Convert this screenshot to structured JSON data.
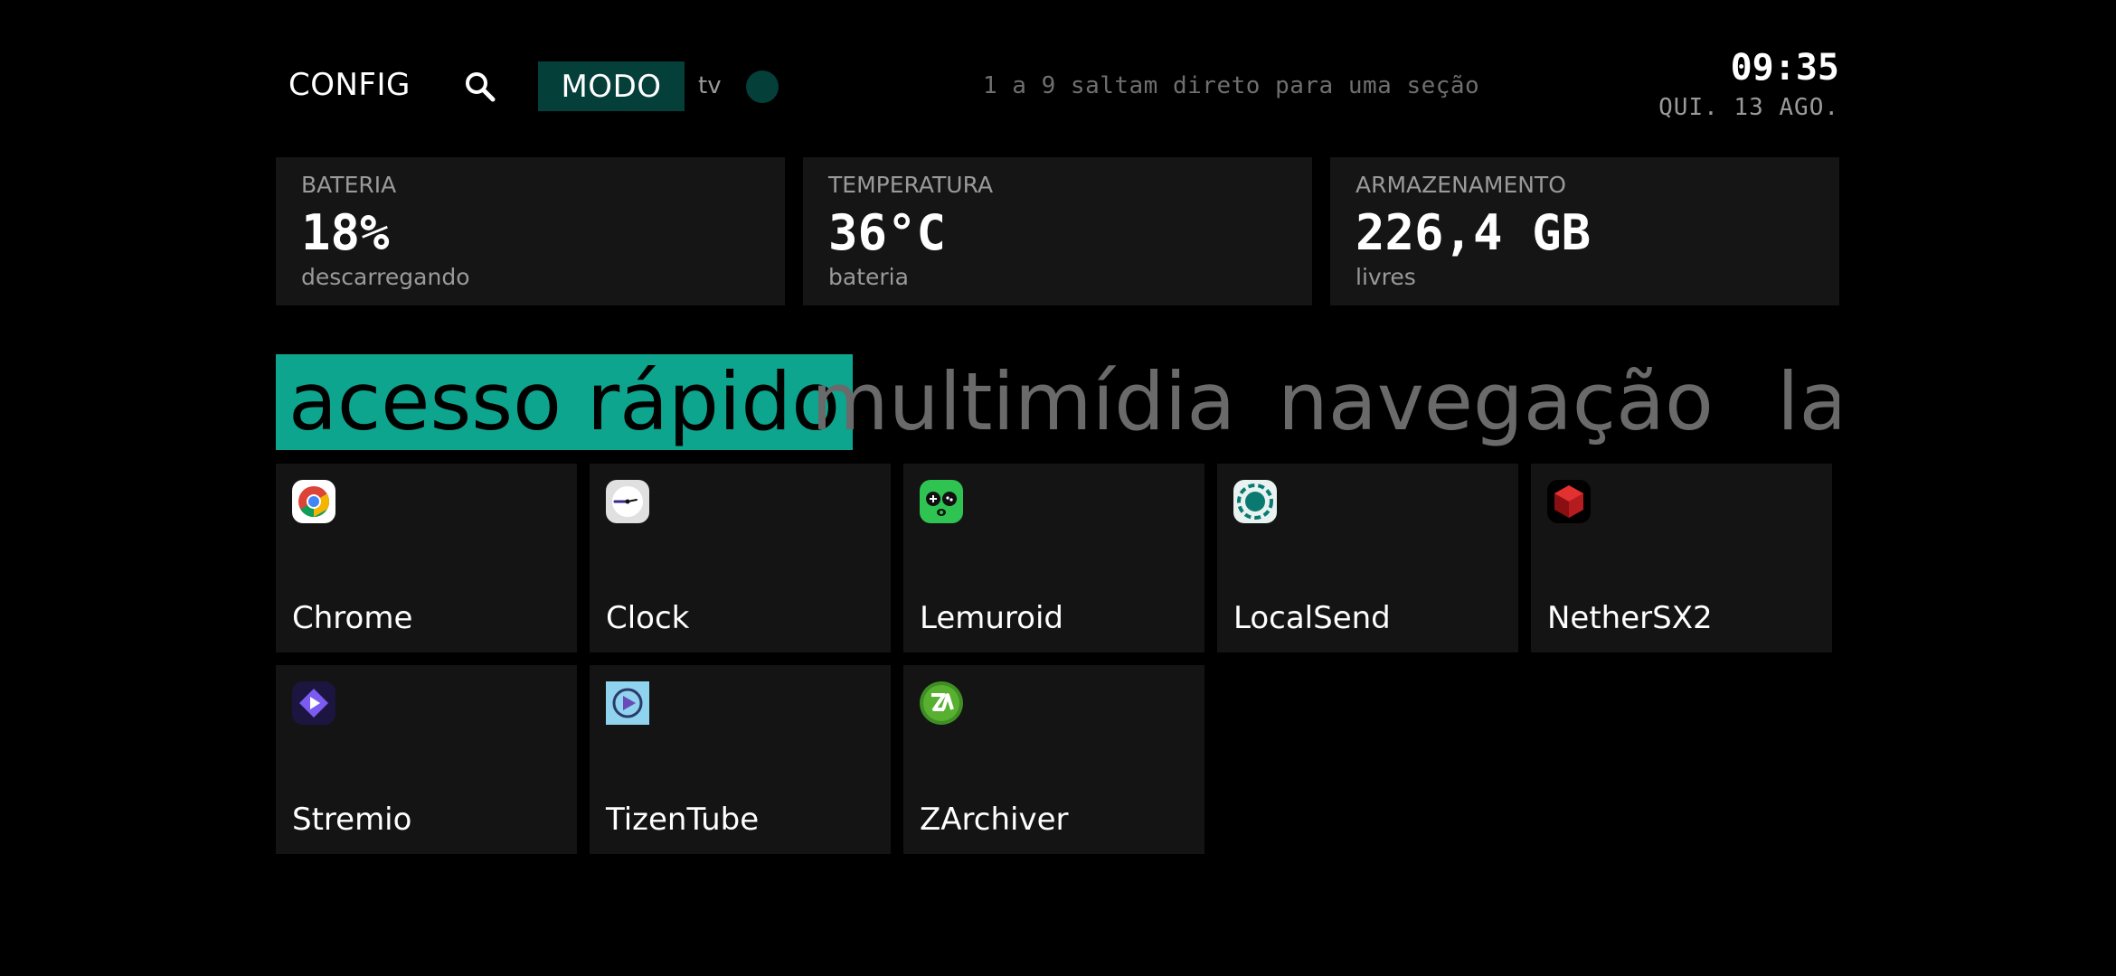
{
  "topbar": {
    "config_label": "CONFIG",
    "mode_label": "MODO",
    "mode_value": "tv",
    "hint": "1 a 9 saltam direto para uma seção",
    "time": "09:35",
    "date": "QUI. 13 AGO."
  },
  "stats": [
    {
      "label": "BATERIA",
      "value": "18%",
      "sub": "descarregando"
    },
    {
      "label": "TEMPERATURA",
      "value": "36°C",
      "sub": "bateria"
    },
    {
      "label": "ARMAZENAMENTO",
      "value": "226,4 GB",
      "sub": "livres"
    }
  ],
  "tabs": [
    {
      "label": "acesso rápido",
      "active": true
    },
    {
      "label": "multimídia",
      "active": false
    },
    {
      "label": "navegação",
      "active": false
    },
    {
      "label": "la",
      "active": false
    }
  ],
  "apps": [
    {
      "name": "Chrome",
      "icon": "chrome-icon"
    },
    {
      "name": "Clock",
      "icon": "clock-icon"
    },
    {
      "name": "Lemuroid",
      "icon": "lemuroid-icon"
    },
    {
      "name": "LocalSend",
      "icon": "localsend-icon"
    },
    {
      "name": "NetherSX2",
      "icon": "nethersx2-icon"
    },
    {
      "name": "Stremio",
      "icon": "stremio-icon"
    },
    {
      "name": "TizenTube",
      "icon": "tizentube-icon"
    },
    {
      "name": "ZArchiver",
      "icon": "zarchiver-icon"
    }
  ],
  "colors": {
    "accent": "#0ea58e",
    "mode_bg": "#053f3a",
    "card_bg": "#151515",
    "background": "#000000"
  }
}
